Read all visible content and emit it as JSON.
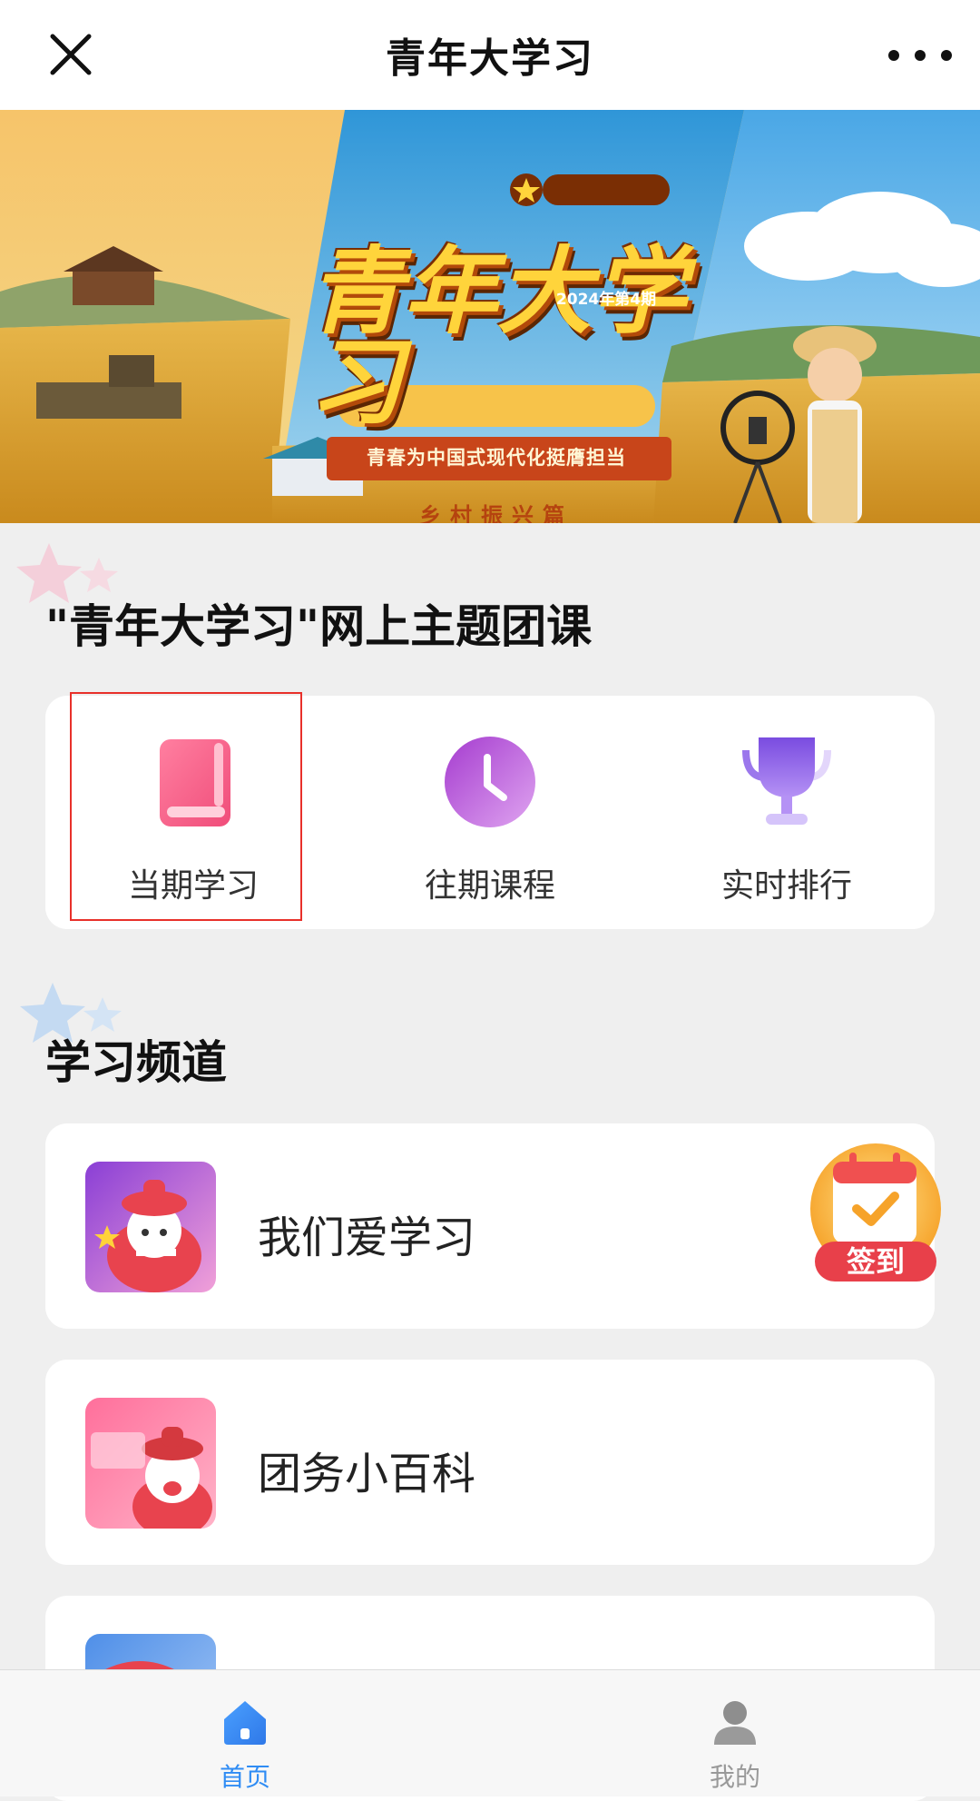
{
  "header": {
    "title": "青年大学习",
    "close_icon": "close-icon",
    "more_icon": "more-icon"
  },
  "banner": {
    "big_title": "青年大学习",
    "issue": "2024年第4期",
    "slogan": "青春为中国式现代化挺膺担当",
    "chapter": "乡村振兴篇"
  },
  "section_course": {
    "title": "\"青年大学习\"网上主题团课",
    "items": [
      {
        "label": "当期学习",
        "icon": "book-icon",
        "color": "#f26d8f"
      },
      {
        "label": "往期课程",
        "icon": "clock-icon",
        "color": "#b35ad8"
      },
      {
        "label": "实时排行",
        "icon": "trophy-icon",
        "color": "#8a5be8"
      }
    ]
  },
  "section_channel": {
    "title": "学习频道",
    "items": [
      {
        "label": "我们爱学习",
        "icon": "mascot-thumbs-up-icon"
      },
      {
        "label": "团务小百科",
        "icon": "mascot-cheer-icon"
      },
      {
        "label": "",
        "icon": "mascot-flag-icon"
      }
    ]
  },
  "signin": {
    "label": "签到",
    "icon": "calendar-check-icon"
  },
  "tabbar": {
    "items": [
      {
        "label": "首页",
        "icon": "home-icon",
        "active": true,
        "color": "#2f8cf4"
      },
      {
        "label": "我的",
        "icon": "user-icon",
        "active": false,
        "color": "#999999"
      }
    ]
  },
  "colors": {
    "accent": "#2f8cf4",
    "highlight_border": "#e8302a",
    "page_bg": "#efefef"
  }
}
